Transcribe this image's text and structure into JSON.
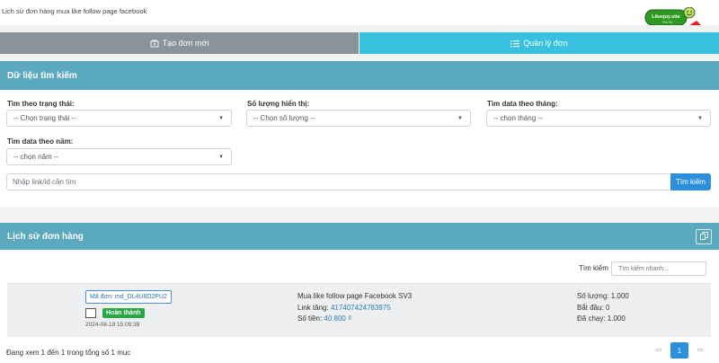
{
  "header": {
    "page_title": "Lịch sử đơn hàng mua like follow page facebook",
    "logo_text": "Likequy.site",
    "logo_subtext": "Mua like"
  },
  "tabs": [
    {
      "label": "Tạo đơn mới",
      "icon": "cart-icon",
      "active": false
    },
    {
      "label": "Quản lý đơn",
      "icon": "list-icon",
      "active": true
    }
  ],
  "search_panel": {
    "title": "Dữ liệu tìm kiếm",
    "filters": [
      {
        "label": "Tìm theo trạng thái:",
        "value": "-- Chọn trạng thái --"
      },
      {
        "label": "Số lượng hiển thị:",
        "value": "-- Chọn số lượng --"
      },
      {
        "label": "Tìm data theo tháng:",
        "value": "-- chọn tháng --"
      },
      {
        "label": "Tìm data theo năm:",
        "value": "-- chọn năm --"
      }
    ],
    "link_placeholder": "Nhập link/id cần tìm",
    "search_button": "Tìm kiếm"
  },
  "history_panel": {
    "title": "Lịch sử đơn hàng",
    "quick_search_label": "Tìm kiếm",
    "quick_search_placeholder": "Tìm kiếm nhanh...",
    "orders": [
      {
        "code": "Mã đơn: md_DL4U8D2PU2",
        "status": "Hoàn thành",
        "time": "2024-08-19 15:09:38",
        "service": "Mua like follow page Facebook SV3",
        "link_label": "Link tăng:",
        "link_value": "417407424783975",
        "amount_label": "Số tiền:",
        "amount_value": "40.800 ₫",
        "quantity": "Số lượng: 1.000",
        "start": "Bắt đầu: 0",
        "ran": "Đã chạy: 1.000"
      }
    ],
    "footer_info": "Đang xem 1 đến 1 trong tổng số 1 mục",
    "current_page": "1"
  },
  "colors": {
    "panel_header": "#5aa9bf",
    "tab_inactive": "#8a929c",
    "tab_active": "#38c1df",
    "primary_button": "#2b8fdc",
    "success": "#28a745",
    "link": "#2c7cc9"
  }
}
